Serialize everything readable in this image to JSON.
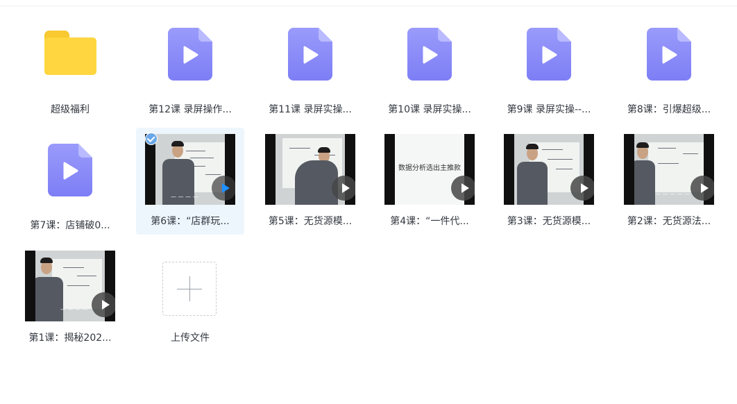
{
  "colors": {
    "folder": "#ffd640",
    "video_icon_top": "#9a9bfb",
    "video_icon_bottom": "#7d7ef5",
    "selected_bg": "#eef6fd"
  },
  "items": [
    {
      "label": "超级福利",
      "kind": "folder-icon"
    },
    {
      "label": "第12课 录屏操作...",
      "kind": "video-file-icon"
    },
    {
      "label": "第11课 录屏实操...",
      "kind": "video-file-icon"
    },
    {
      "label": "第10课 录屏实操...",
      "kind": "video-file-icon"
    },
    {
      "label": "第9课 录屏实操--...",
      "kind": "video-file-icon"
    },
    {
      "label": "第8课：引爆超级...",
      "kind": "video-file-icon"
    },
    {
      "label": "第7课：店铺破0...",
      "kind": "video-file-icon"
    },
    {
      "label": "第6课：“店群玩...",
      "kind": "video-thumbnail",
      "selected": true
    },
    {
      "label": "第5课：无货源模...",
      "kind": "video-thumbnail"
    },
    {
      "label": "第4课：“一件代...",
      "kind": "video-thumbnail",
      "thumb_text": "数据分析选出主推款"
    },
    {
      "label": "第3课：无货源模...",
      "kind": "video-thumbnail"
    },
    {
      "label": "第2课：无货源法...",
      "kind": "video-thumbnail"
    },
    {
      "label": "第1课：揭秘202...",
      "kind": "video-thumbnail"
    }
  ],
  "upload": {
    "label": "上传文件",
    "icon": "plus-icon"
  }
}
